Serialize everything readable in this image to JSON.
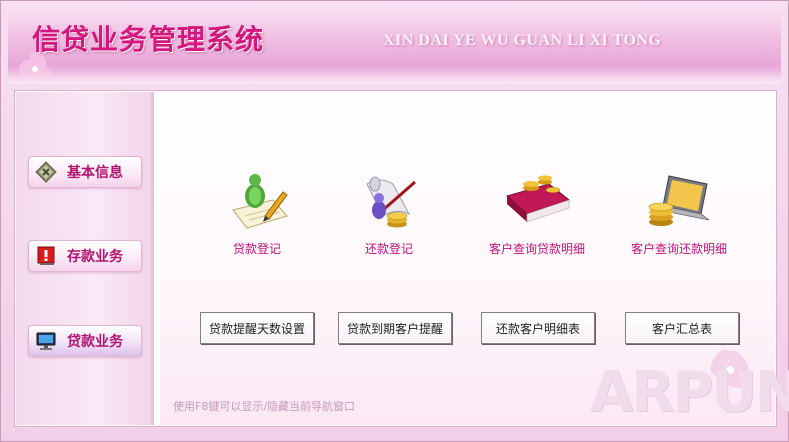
{
  "header": {
    "title_cn": "信贷业务管理系统",
    "title_en": "XIN DAI YE WU GUAN LI XI TONG"
  },
  "sidebar": {
    "items": [
      {
        "label": "基本信息",
        "icon": "basic-info-icon"
      },
      {
        "label": "存款业务",
        "icon": "deposit-warning-icon"
      },
      {
        "label": "贷款业务",
        "icon": "monitor-icon",
        "active": true
      }
    ]
  },
  "main": {
    "functions": [
      {
        "label": "贷款登记",
        "icon": "loan-register-icon"
      },
      {
        "label": "还款登记",
        "icon": "repay-register-icon"
      },
      {
        "label": "客户查询贷款明细",
        "icon": "customer-loan-detail-icon"
      },
      {
        "label": "客户查询还款明细",
        "icon": "customer-repay-detail-icon"
      }
    ],
    "buttons": [
      {
        "label": "贷款提醒天数设置"
      },
      {
        "label": "贷款到期客户提醒"
      },
      {
        "label": "还款客户明细表"
      },
      {
        "label": "客户汇总表"
      }
    ],
    "hint": "使用F8键可以显示/隐藏当前导航窗口"
  },
  "watermark": "ARPUN",
  "colors": {
    "brand": "#d4167d",
    "nav_text": "#b0146e",
    "func_text": "#c0127a",
    "background": "#f1cfe8"
  }
}
